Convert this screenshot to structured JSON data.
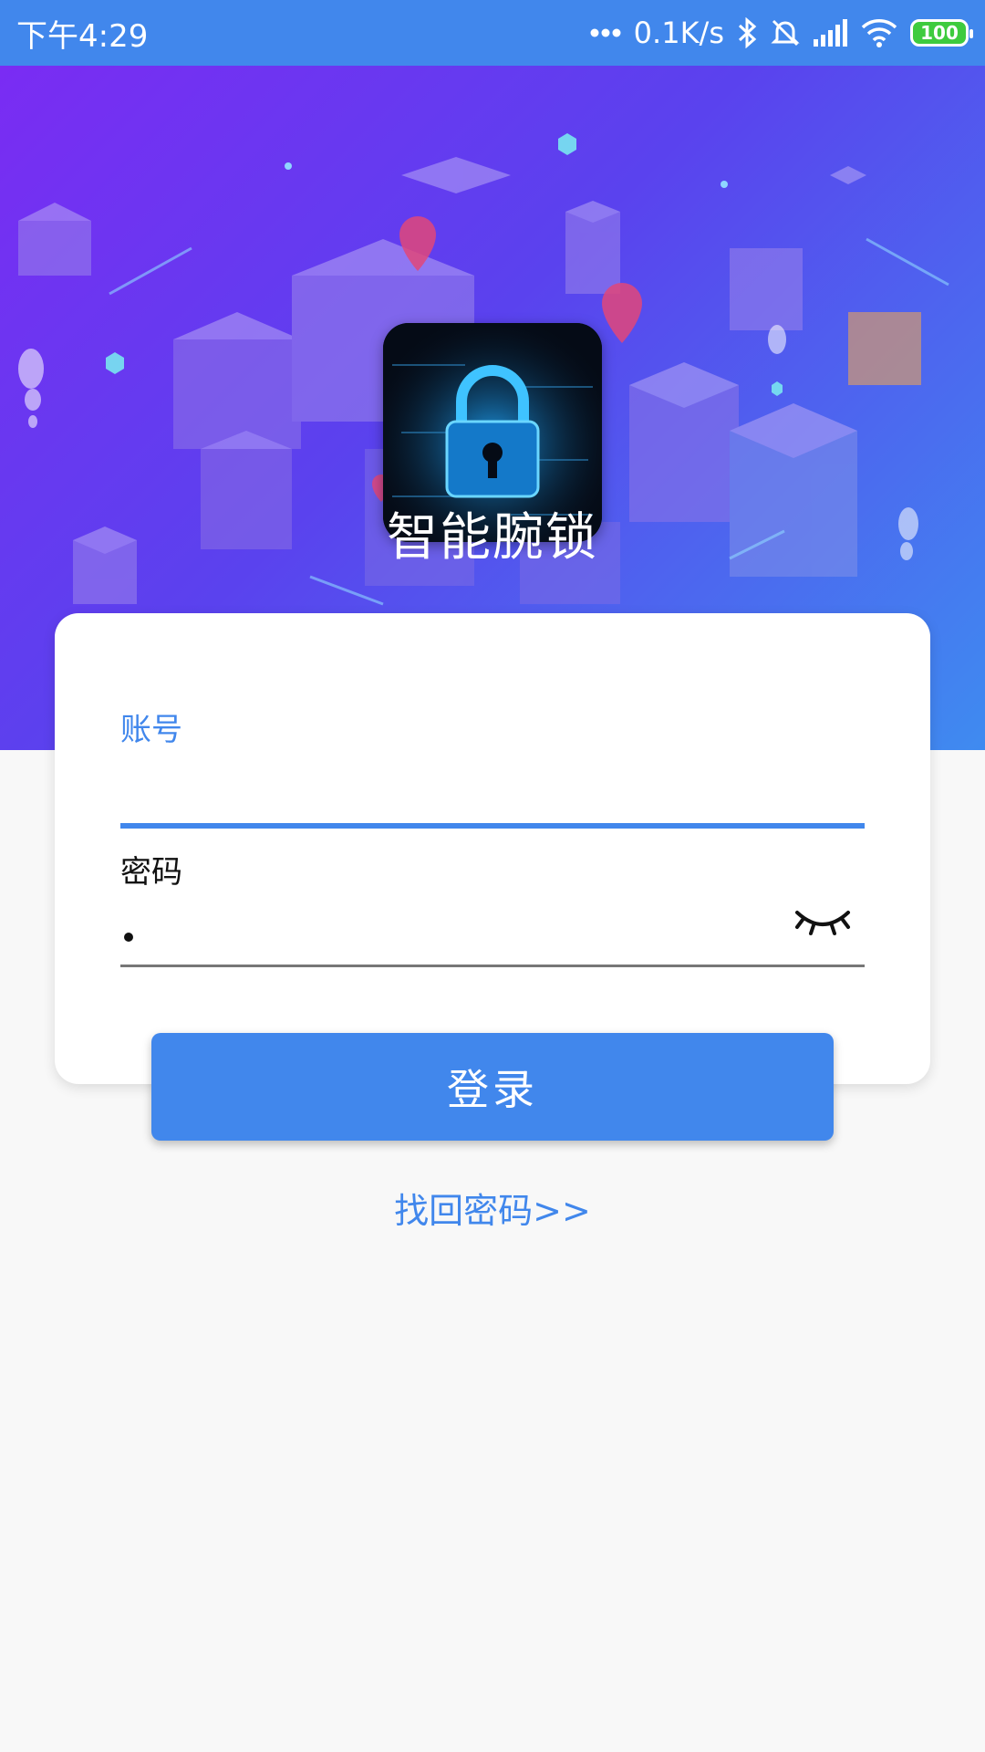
{
  "status_bar": {
    "time": "下午4:29",
    "network_speed": "0.1K/s",
    "battery_level": "100",
    "icons": [
      "more-dots-icon",
      "bluetooth-icon",
      "mute-icon",
      "signal-icon",
      "wifi-icon",
      "battery-icon"
    ]
  },
  "app": {
    "title": "智能腕锁",
    "logo_icon": "lock-icon"
  },
  "login_form": {
    "account_label": "账号",
    "account_value": "",
    "password_label": "密码",
    "password_visibility_icon": "eye-closed-icon",
    "login_button": "登录",
    "find_password_link": "找回密码>>"
  },
  "colors": {
    "primary": "#4187ec",
    "banner_start": "#7a2cf3",
    "banner_end": "#3f8bf0",
    "battery": "#3ecb3e"
  }
}
